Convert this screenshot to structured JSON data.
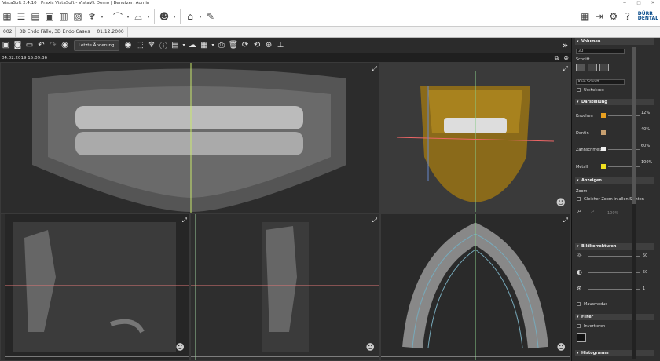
{
  "titlebar": {
    "text": "VistaSoft 2.4.10 | Praxis VistaSoft - VistaVit Demo | Benutzer: Admin",
    "minimize": "─",
    "maximize": "□",
    "close": "✕"
  },
  "logo": {
    "line1": "DÜRR",
    "line2": "DENTAL"
  },
  "patient": {
    "id": "002",
    "cases": "3D Endo Fälle, 3D Endo Cases",
    "dob": "01.12.2000"
  },
  "toolbar2": {
    "dropdown_label": "Letzte Änderung",
    "expand": "»"
  },
  "view": {
    "timestamp": "04.02.2019 15:09:36"
  },
  "panel": {
    "volumen": "Volumen",
    "mode_value": "3D",
    "schnitt": "Schnitt",
    "schnitt_value": "Kein Schnitt",
    "umkehren": "Umkehren",
    "darstellung": "Darstellung",
    "knochen": "Knochen",
    "knochen_pct": "12%",
    "dentin": "Dentin",
    "dentin_pct": "40%",
    "zahnschmelz": "Zahnschmelz",
    "zahnschmelz_pct": "60%",
    "metall": "Metall",
    "metall_pct": "100%",
    "anzeigen": "Anzeigen",
    "zoom": "Zoom",
    "gleicher_zoom": "Gleicher Zoom in allen Sichten",
    "zoom_value": "100%",
    "bildkorrekturen": "Bildkorrekturen",
    "brightness_value": "50",
    "contrast_value": "50",
    "gamma_value": "1",
    "mausmodus": "Mausmodus",
    "filter": "Filter",
    "invertieren": "Invertieren",
    "histogramm": "Histogramm"
  },
  "colors": {
    "knochen": "#e8a020",
    "dentin": "#c8a070",
    "zahnschmelz": "#eeeeee",
    "metall": "#f0e020"
  }
}
